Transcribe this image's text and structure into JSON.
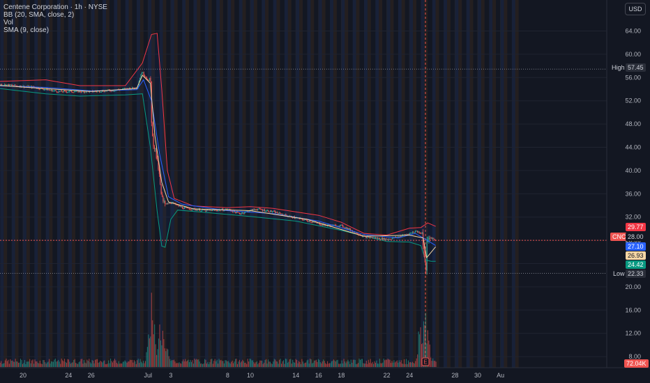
{
  "legend": {
    "title": "Centene Corporation · 1h · NYSE",
    "bb": "BB (20, SMA, close, 2)",
    "vol": "Vol",
    "sma": "SMA (9, close)"
  },
  "currency_button": "USD",
  "earnings_marker": "E",
  "colors": {
    "background": "#131722",
    "up": "#26a69a",
    "down": "#ef5350",
    "bb_upper": "#f23645",
    "bb_lower": "#089981",
    "bb_basis": "#2962ff",
    "sma": "#f5d6a4",
    "session_ext_blue": "#1e2a4a",
    "session_ext_orange": "#3a2a1e"
  },
  "price_tags": {
    "high_label": "High",
    "high_value": "57.45",
    "ticker": "CNC",
    "last_value": "28.00",
    "bb_upper_value": "29.77",
    "bb_basis_value": "27.10",
    "sma_value": "26.93",
    "bb_lower_value": "24.42",
    "low_label": "Low",
    "low_value": "22.33",
    "volume_value": "72.04K"
  },
  "chart_data": {
    "type": "candlestick",
    "symbol": "CNC",
    "interval": "1h",
    "ylim": [
      5,
      67
    ],
    "y_ticks": [
      "64.00",
      "60.00",
      "56.00",
      "52.00",
      "48.00",
      "44.00",
      "40.00",
      "36.00",
      "32.00",
      "28.00",
      "24.00",
      "20.00",
      "16.00",
      "12.00",
      "8.00"
    ],
    "y_tick_values": [
      64,
      60,
      56,
      52,
      48,
      44,
      40,
      36,
      32,
      28,
      24,
      20,
      16,
      12,
      8
    ],
    "x_ticks": [
      "20",
      "24",
      "26",
      "Jul",
      "3",
      "8",
      "10",
      "14",
      "16",
      "18",
      "22",
      "24",
      "28",
      "30",
      "Au"
    ],
    "x_tick_days": [
      -10,
      -6,
      -4,
      1,
      3,
      8,
      10,
      14,
      16,
      18,
      22,
      24,
      28,
      30,
      32
    ],
    "high": 57.45,
    "low": 22.33,
    "last": 28.0,
    "close_path": [
      {
        "day": -12.5,
        "price": 54.9
      },
      {
        "day": -9,
        "price": 54.3
      },
      {
        "day": -7,
        "price": 53.6
      },
      {
        "day": -4,
        "price": 53.6
      },
      {
        "day": -2,
        "price": 53.8
      },
      {
        "day": 0,
        "price": 54.3
      },
      {
        "day": 0.4,
        "price": 57.0
      },
      {
        "day": 1.2,
        "price": 55.0
      },
      {
        "day": 1.3,
        "price": 46.0
      },
      {
        "day": 1.6,
        "price": 43.5
      },
      {
        "day": 1.9,
        "price": 40.0
      },
      {
        "day": 2.1,
        "price": 36.0
      },
      {
        "day": 2.3,
        "price": 34.3
      },
      {
        "day": 3,
        "price": 34.5
      },
      {
        "day": 4,
        "price": 33.6
      },
      {
        "day": 6,
        "price": 33.1
      },
      {
        "day": 8,
        "price": 33.3
      },
      {
        "day": 9,
        "price": 32.6
      },
      {
        "day": 10.5,
        "price": 33.4
      },
      {
        "day": 12,
        "price": 32.9
      },
      {
        "day": 13,
        "price": 32.3
      },
      {
        "day": 15,
        "price": 31.4
      },
      {
        "day": 16.5,
        "price": 30.6
      },
      {
        "day": 18,
        "price": 30.5
      },
      {
        "day": 20,
        "price": 28.6
      },
      {
        "day": 22,
        "price": 28.2
      },
      {
        "day": 23,
        "price": 28.6
      },
      {
        "day": 24,
        "price": 29.2
      },
      {
        "day": 24.5,
        "price": 29.6
      },
      {
        "day": 25.1,
        "price": 29.2
      },
      {
        "day": 25.3,
        "price": 24.0
      },
      {
        "day": 25.4,
        "price": 22.8
      },
      {
        "day": 25.5,
        "price": 27.6
      },
      {
        "day": 25.8,
        "price": 28.5
      },
      {
        "day": 26.3,
        "price": 28.0
      }
    ],
    "bb_upper": [
      {
        "day": -12.5,
        "price": 55.3
      },
      {
        "day": -8,
        "price": 55.6
      },
      {
        "day": -5,
        "price": 54.6
      },
      {
        "day": -1,
        "price": 54.6
      },
      {
        "day": 0.5,
        "price": 58.5
      },
      {
        "day": 1.3,
        "price": 63.4
      },
      {
        "day": 1.8,
        "price": 63.6
      },
      {
        "day": 2.2,
        "price": 54.0
      },
      {
        "day": 2.7,
        "price": 40.0
      },
      {
        "day": 3.3,
        "price": 35.2
      },
      {
        "day": 5,
        "price": 33.9
      },
      {
        "day": 8,
        "price": 33.6
      },
      {
        "day": 10,
        "price": 33.8
      },
      {
        "day": 12,
        "price": 33.5
      },
      {
        "day": 14,
        "price": 32.9
      },
      {
        "day": 16,
        "price": 32.3
      },
      {
        "day": 18,
        "price": 31.1
      },
      {
        "day": 20,
        "price": 29.2
      },
      {
        "day": 22,
        "price": 28.9
      },
      {
        "day": 24,
        "price": 30.1
      },
      {
        "day": 25,
        "price": 30.2
      },
      {
        "day": 25.6,
        "price": 31.0
      },
      {
        "day": 26.3,
        "price": 30.4
      }
    ],
    "bb_basis": [
      {
        "day": -12.5,
        "price": 54.6
      },
      {
        "day": -8,
        "price": 54.3
      },
      {
        "day": -4,
        "price": 53.7
      },
      {
        "day": 0,
        "price": 53.9
      },
      {
        "day": 0.6,
        "price": 55.6
      },
      {
        "day": 1.3,
        "price": 52.0
      },
      {
        "day": 2.0,
        "price": 43.0
      },
      {
        "day": 2.8,
        "price": 35.5
      },
      {
        "day": 4,
        "price": 34.2
      },
      {
        "day": 8,
        "price": 33.1
      },
      {
        "day": 12,
        "price": 32.6
      },
      {
        "day": 16,
        "price": 31.3
      },
      {
        "day": 20,
        "price": 29.0
      },
      {
        "day": 23,
        "price": 28.4
      },
      {
        "day": 24.5,
        "price": 29.2
      },
      {
        "day": 25.3,
        "price": 28.3
      },
      {
        "day": 26.3,
        "price": 27.1
      }
    ],
    "bb_lower": [
      {
        "day": -12.5,
        "price": 54.2
      },
      {
        "day": -8,
        "price": 53.2
      },
      {
        "day": -5,
        "price": 52.8
      },
      {
        "day": -1,
        "price": 53.0
      },
      {
        "day": 0.5,
        "price": 53.2
      },
      {
        "day": 1.2,
        "price": 44.0
      },
      {
        "day": 1.8,
        "price": 33.0
      },
      {
        "day": 2.2,
        "price": 27.0
      },
      {
        "day": 2.5,
        "price": 26.8
      },
      {
        "day": 3.0,
        "price": 31.6
      },
      {
        "day": 3.6,
        "price": 33.2
      },
      {
        "day": 6,
        "price": 32.8
      },
      {
        "day": 10,
        "price": 32.1
      },
      {
        "day": 14,
        "price": 31.3
      },
      {
        "day": 18,
        "price": 29.7
      },
      {
        "day": 22,
        "price": 27.8
      },
      {
        "day": 24,
        "price": 27.7
      },
      {
        "day": 25.0,
        "price": 27.1
      },
      {
        "day": 25.4,
        "price": 24.6
      },
      {
        "day": 25.9,
        "price": 24.4
      },
      {
        "day": 26.3,
        "price": 24.4
      }
    ],
    "sma_9": [
      {
        "day": -12.5,
        "price": 54.7
      },
      {
        "day": -8,
        "price": 54.1
      },
      {
        "day": -4,
        "price": 53.6
      },
      {
        "day": 0,
        "price": 54.1
      },
      {
        "day": 0.5,
        "price": 56.4
      },
      {
        "day": 1.2,
        "price": 55.0
      },
      {
        "day": 1.6,
        "price": 46.0
      },
      {
        "day": 2.2,
        "price": 38.0
      },
      {
        "day": 2.8,
        "price": 34.6
      },
      {
        "day": 5,
        "price": 33.4
      },
      {
        "day": 10,
        "price": 33.1
      },
      {
        "day": 15,
        "price": 31.6
      },
      {
        "day": 20,
        "price": 28.7
      },
      {
        "day": 24,
        "price": 28.9
      },
      {
        "day": 25.2,
        "price": 28.4
      },
      {
        "day": 25.5,
        "price": 25.0
      },
      {
        "day": 26.3,
        "price": 26.9
      }
    ],
    "volume_spikes": [
      {
        "day": 1.0,
        "value": 0.35
      },
      {
        "day": 1.3,
        "value": 0.88
      },
      {
        "day": 1.5,
        "value": 0.55
      },
      {
        "day": 2.0,
        "value": 0.45
      },
      {
        "day": 2.3,
        "value": 0.33
      },
      {
        "day": 2.6,
        "value": 0.22
      },
      {
        "day": 24.9,
        "value": 0.55
      },
      {
        "day": 25.3,
        "value": 0.7
      },
      {
        "day": 25.6,
        "value": 0.45
      }
    ],
    "earnings_day": 25.4
  }
}
